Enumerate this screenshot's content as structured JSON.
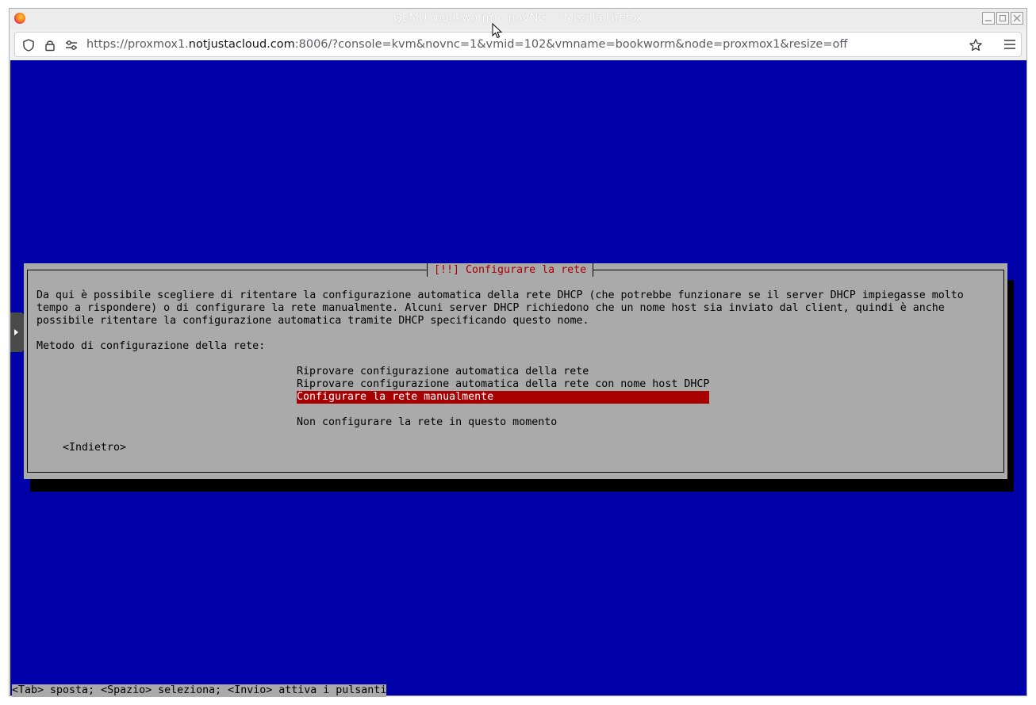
{
  "window": {
    "title": "QEMU (bookworm) - noVNC — Mozilla Firefox"
  },
  "urlbar": {
    "url_prefix": "https://proxmox1.",
    "url_host": "notjustacloud.com",
    "url_suffix": ":8006/?console=kvm&novnc=1&vmid=102&vmname=bookworm&node=proxmox1&resize=off"
  },
  "icons": {
    "shield": "shield-icon",
    "lock": "lock-icon",
    "permissions": "permissions-icon",
    "bookmark": "star-icon",
    "menu": "hamburger-menu-icon",
    "novnc_handle": "chevron-right-icon"
  },
  "colors": {
    "console_bg": "#0000a8",
    "dialog_bg": "#aaaaaa",
    "dialog_title": "#a80000",
    "selected_bg": "#a80000",
    "selected_fg": "#ffffff"
  },
  "installer": {
    "dialog_title": "[!!] Configurare la rete",
    "description": "Da qui è possibile scegliere di ritentare la configurazione automatica della rete DHCP (che potrebbe funzionare se il server DHCP impiegasse molto\ntempo a rispondere) o di configurare la rete manualmente. Alcuni server DHCP richiedono che un nome host sia inviato dal client, quindi è anche\npossibile ritentare la configurazione automatica tramite DHCP specificando questo nome.",
    "method_label": "Metodo di configurazione della rete:",
    "options": [
      "Riprovare configurazione automatica della rete",
      "Riprovare configurazione automatica della rete con nome host DHCP",
      "Configurare la rete manualmente",
      "Non configurare la rete in questo momento"
    ],
    "selected_index": 2,
    "back_button": "<Indietro>",
    "help_line": "<Tab> sposta; <Spazio> seleziona; <Invio> attiva i pulsanti"
  }
}
